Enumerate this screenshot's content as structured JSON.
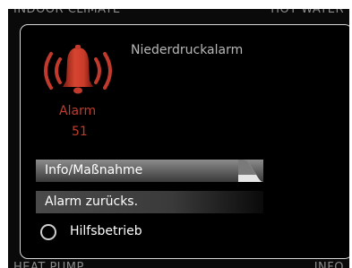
{
  "background": {
    "top_left": "INDOOR CLIMATE",
    "top_right": "HOT WATER",
    "bottom_left": "HEAT PUMP",
    "bottom_right": "INFO"
  },
  "dialog": {
    "title": "Niederdruckalarm",
    "alarm_icon": "bell-icon",
    "alarm_color": "#c23a2d",
    "alarm_label": "Alarm",
    "alarm_code": "51",
    "menu": {
      "selected_item": "Info/Maßnahme",
      "reset_item": "Alarm zurücks.",
      "aid_mode_label": "Hilfsbetrieb",
      "aid_mode_checked": false
    }
  }
}
